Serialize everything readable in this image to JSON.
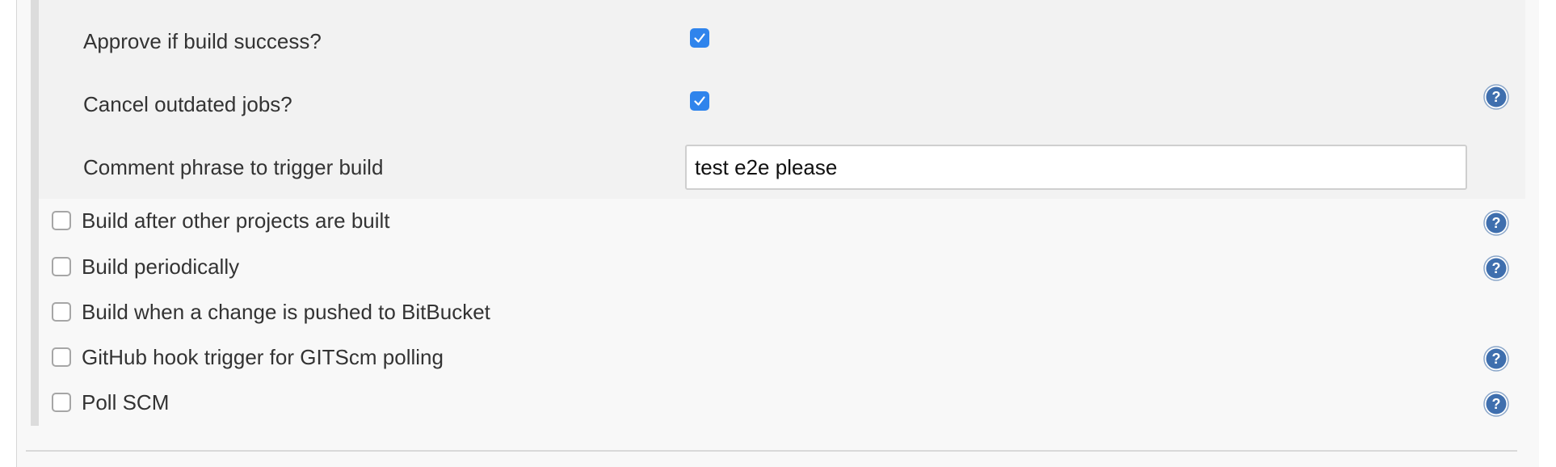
{
  "trigger_options": {
    "approve_label": "Approve if build success?",
    "approve_checked": true,
    "cancel_label": "Cancel outdated jobs?",
    "cancel_checked": true,
    "comment_label": "Comment phrase to trigger build",
    "comment_value": "test e2e please"
  },
  "build_triggers": [
    {
      "label": "Build after other projects are built",
      "checked": false,
      "help": true
    },
    {
      "label": "Build periodically",
      "checked": false,
      "help": true
    },
    {
      "label": "Build when a change is pushed to BitBucket",
      "checked": false,
      "help": false
    },
    {
      "label": "GitHub hook trigger for GITScm polling",
      "checked": false,
      "help": true
    },
    {
      "label": "Poll SCM",
      "checked": false,
      "help": true
    }
  ],
  "icons": {
    "checkbox_checked": "checkmark-icon",
    "help": "help-icon"
  },
  "colors": {
    "checkbox_accent": "#2f84ec",
    "help_icon": "#3f6fae",
    "nested_background": "#f2f2f2",
    "section_background": "#f8f8f8"
  }
}
